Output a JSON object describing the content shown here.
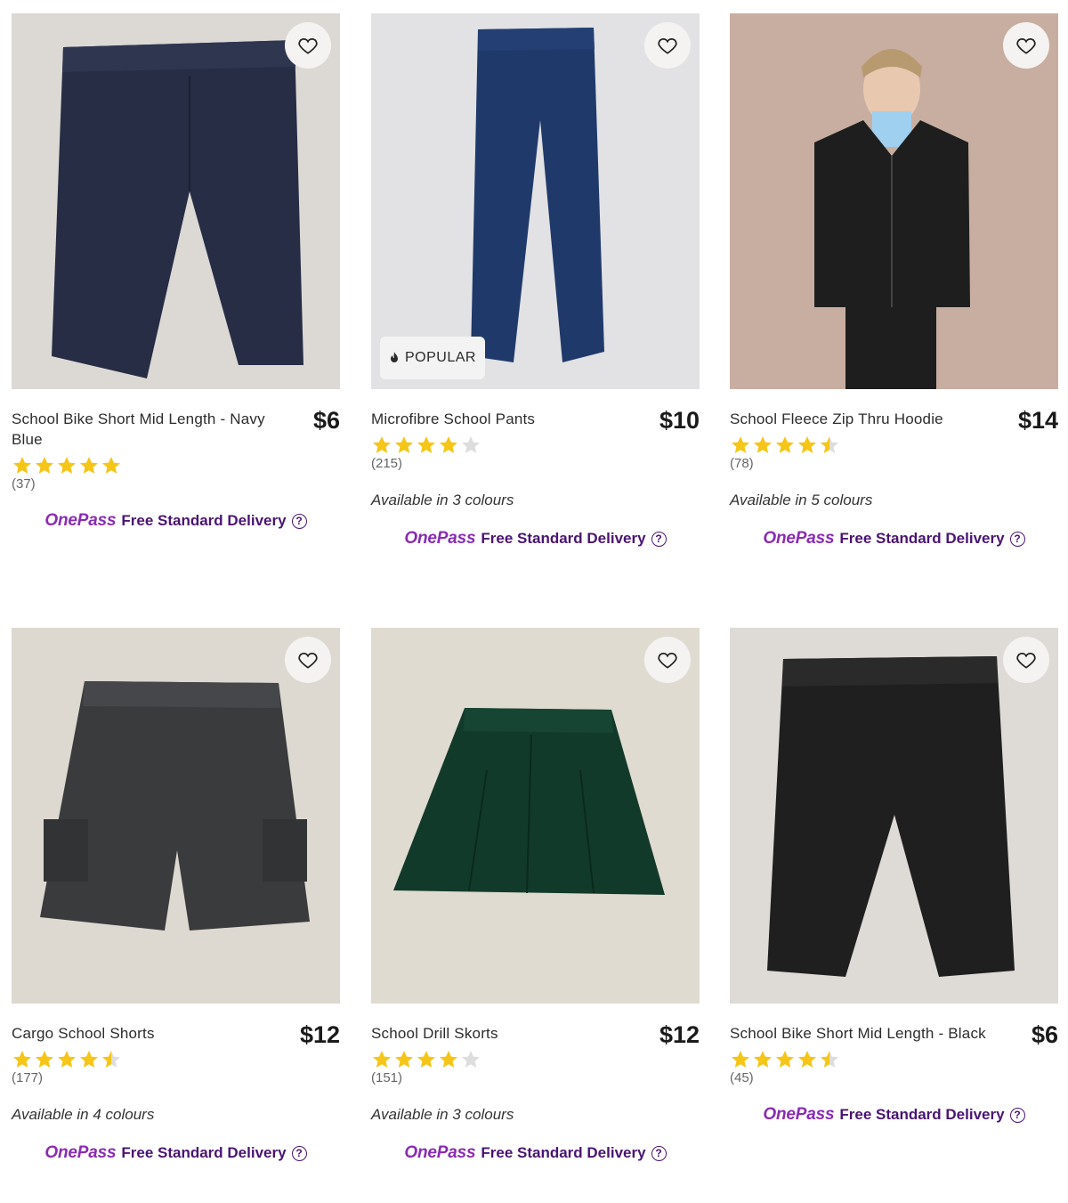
{
  "colors": {
    "star": "#f5c518",
    "star_empty": "#dddddd",
    "onepass": "#8a2bb3",
    "onepass_text": "#4a1473"
  },
  "products": [
    {
      "name": "School Bike Short Mid Length - Navy Blue",
      "price": "$6",
      "rating": 5,
      "reviews": "(37)",
      "colours": "",
      "badge": "",
      "delivery_brand": "OnePass",
      "delivery_text": "Free Standard Delivery",
      "image": "navy-bike-shorts",
      "help_icon": "question-circle-icon"
    },
    {
      "name": "Microfibre School Pants",
      "price": "$10",
      "rating": 4,
      "reviews": "(215)",
      "colours": "Available in 3 colours",
      "badge": "POPULAR",
      "delivery_brand": "OnePass",
      "delivery_text": "Free Standard Delivery",
      "image": "navy-school-pants",
      "help_icon": "question-circle-icon"
    },
    {
      "name": "School Fleece Zip Thru Hoodie",
      "price": "$14",
      "rating": 4.5,
      "reviews": "(78)",
      "colours": "Available in 5 colours",
      "badge": "",
      "delivery_brand": "OnePass",
      "delivery_text": "Free Standard Delivery",
      "image": "black-hoodie-model",
      "help_icon": "question-circle-icon"
    },
    {
      "name": "Cargo School Shorts",
      "price": "$12",
      "rating": 4.5,
      "reviews": "(177)",
      "colours": "Available in 4 colours",
      "badge": "",
      "delivery_brand": "OnePass",
      "delivery_text": "Free Standard Delivery",
      "image": "grey-cargo-shorts",
      "help_icon": "question-circle-icon"
    },
    {
      "name": "School Drill Skorts",
      "price": "$12",
      "rating": 4,
      "reviews": "(151)",
      "colours": "Available in 3 colours",
      "badge": "",
      "delivery_brand": "OnePass",
      "delivery_text": "Free Standard Delivery",
      "image": "green-drill-skort",
      "help_icon": "question-circle-icon"
    },
    {
      "name": "School Bike Short Mid Length - Black",
      "price": "$6",
      "rating": 4.5,
      "reviews": "(45)",
      "colours": "",
      "badge": "",
      "delivery_brand": "OnePass",
      "delivery_text": "Free Standard Delivery",
      "image": "black-bike-shorts",
      "help_icon": "question-circle-icon"
    }
  ]
}
